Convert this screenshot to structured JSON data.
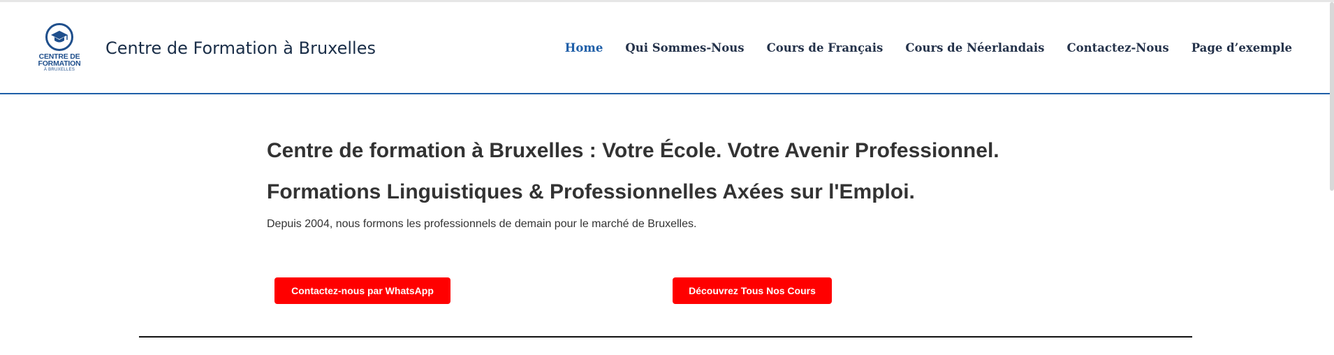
{
  "header": {
    "logo": {
      "line1": "CENTRE DE",
      "line2": "FORMATION",
      "line3": "À BRUXELLES",
      "icon": "graduation-cap-icon",
      "color": "#1f4f8c"
    },
    "site_title": "Centre de Formation à Bruxelles",
    "nav": [
      {
        "label": "Home",
        "active": true
      },
      {
        "label": "Qui Sommes-Nous",
        "active": false
      },
      {
        "label": "Cours de Français",
        "active": false
      },
      {
        "label": "Cours de Néerlandais",
        "active": false
      },
      {
        "label": "Contactez-Nous",
        "active": false
      },
      {
        "label": "Page d’exemple",
        "active": false
      }
    ],
    "accent_color": "#1f5fa8"
  },
  "hero": {
    "title": "Centre de formation à Bruxelles : Votre École. Votre Avenir Professionnel.",
    "subtitle": "Formations Linguistiques & Professionnelles Axées sur l'Emploi.",
    "description": "Depuis 2004, nous formons les professionnels de demain pour le marché de Bruxelles.",
    "buttons": {
      "whatsapp": "Contactez-nous par WhatsApp",
      "cours": "Découvrez Tous Nos Cours"
    },
    "button_color": "#ff0000"
  }
}
